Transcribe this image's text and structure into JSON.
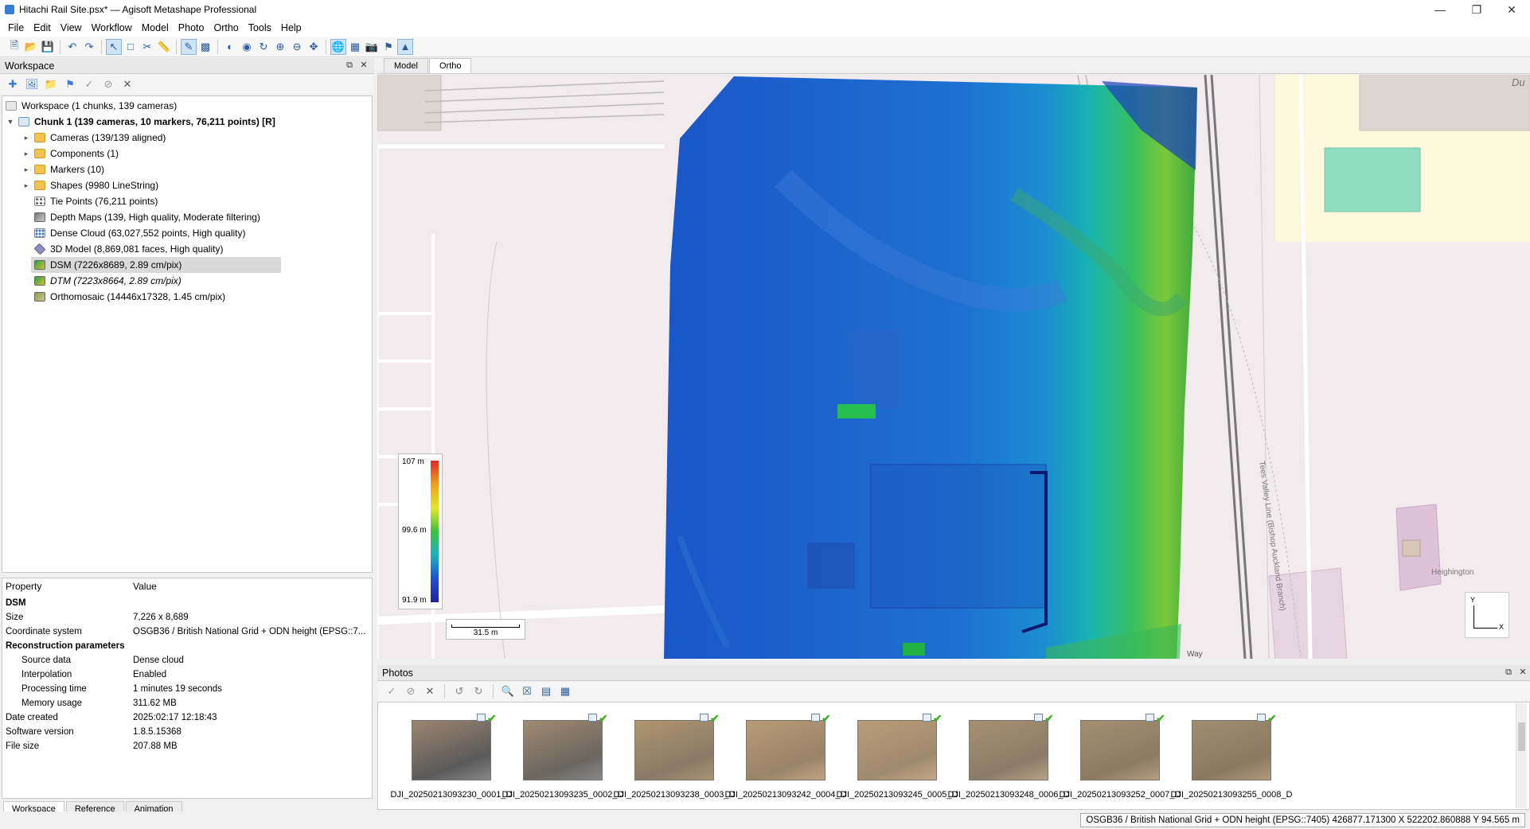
{
  "window": {
    "title": "Hitachi Rail Site.psx* — Agisoft Metashape Professional"
  },
  "menu": [
    "File",
    "Edit",
    "View",
    "Workflow",
    "Model",
    "Photo",
    "Ortho",
    "Tools",
    "Help"
  ],
  "workspace": {
    "panel_title": "Workspace",
    "root": "Workspace (1 chunks, 139 cameras)",
    "chunk": "Chunk 1 (139 cameras, 10 markers, 76,211 points) [R]",
    "items": [
      {
        "label": "Cameras (139/139 aligned)",
        "icon": "folder-icon"
      },
      {
        "label": "Components (1)",
        "icon": "folder-icon"
      },
      {
        "label": "Markers (10)",
        "icon": "folder-icon"
      },
      {
        "label": "Shapes (9980 LineString)",
        "icon": "folder-icon"
      },
      {
        "label": "Tie Points (76,211 points)",
        "icon": "tie-points-icon"
      },
      {
        "label": "Depth Maps (139, High quality, Moderate filtering)",
        "icon": "depth-maps-icon"
      },
      {
        "label": "Dense Cloud (63,027,552 points, High quality)",
        "icon": "dense-cloud-icon"
      },
      {
        "label": "3D Model (8,869,081 faces, High quality)",
        "icon": "model-icon"
      },
      {
        "label": "DSM (7226x8689, 2.89 cm/pix)",
        "icon": "dsm-icon"
      },
      {
        "label": "DTM (7223x8664, 2.89 cm/pix)",
        "icon": "dtm-icon"
      },
      {
        "label": "Orthomosaic (14446x17328, 1.45 cm/pix)",
        "icon": "orthomosaic-icon"
      }
    ]
  },
  "properties": {
    "header_property": "Property",
    "header_value": "Value",
    "rows": [
      {
        "k": "DSM",
        "v": "",
        "section": true
      },
      {
        "k": "Size",
        "v": "7,226 x 8,689"
      },
      {
        "k": "Coordinate system",
        "v": "OSGB36 / British National Grid + ODN height (EPSG::7..."
      },
      {
        "k": "Reconstruction parameters",
        "v": "",
        "section": true
      },
      {
        "k": "Source data",
        "v": "Dense cloud",
        "indent": true
      },
      {
        "k": "Interpolation",
        "v": "Enabled",
        "indent": true
      },
      {
        "k": "Processing time",
        "v": "1 minutes 19 seconds",
        "indent": true
      },
      {
        "k": "Memory usage",
        "v": "311.62 MB",
        "indent": true
      },
      {
        "k": "Date created",
        "v": "2025:02:17 12:18:43"
      },
      {
        "k": "Software version",
        "v": "1.8.5.15368"
      },
      {
        "k": "File size",
        "v": "207.88 MB"
      }
    ]
  },
  "bottom_tabs": [
    "Workspace",
    "Reference",
    "Animation"
  ],
  "view_tabs": [
    "Model",
    "Ortho"
  ],
  "legend": {
    "max": "107 m",
    "mid": "99.6 m",
    "min": "91.9 m"
  },
  "scale": "31.5 m",
  "axes": {
    "y": "Y",
    "x": "X"
  },
  "map_labels": {
    "heighington": "Heighington",
    "railway": "Tees Valley Line (Bishop Auckland Branch)",
    "road": "Way",
    "corner": "Du"
  },
  "photos": {
    "panel_title": "Photos",
    "items": [
      "DJI_20250213093230_0001_D",
      "DJI_20250213093235_0002_D",
      "DJI_20250213093238_0003_D",
      "DJI_20250213093242_0004_D",
      "DJI_20250213093245_0005_D",
      "DJI_20250213093248_0006_D",
      "DJI_20250213093252_0007_D",
      "DJI_20250213093255_0008_D"
    ]
  },
  "status": "OSGB36 / British National Grid + ODN height (EPSG::7405)   426877.171300 X   522202.860888 Y   94.565 m"
}
